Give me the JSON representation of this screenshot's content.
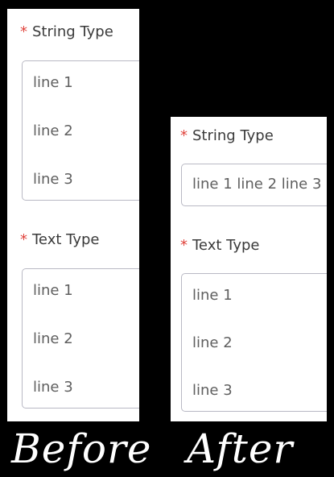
{
  "before": {
    "caption": "Before",
    "fields": [
      {
        "required_mark": "*",
        "label": "String Type",
        "lines": [
          "line 1",
          "line 2",
          "line 3"
        ]
      },
      {
        "required_mark": "*",
        "label": "Text Type",
        "lines": [
          "line 1",
          "line 2",
          "line 3"
        ]
      }
    ]
  },
  "after": {
    "caption": "After",
    "fields": [
      {
        "required_mark": "*",
        "label": "String Type",
        "value": "line 1 line 2 line 3"
      },
      {
        "required_mark": "*",
        "label": "Text Type",
        "lines": [
          "line 1",
          "line 2",
          "line 3"
        ]
      }
    ]
  },
  "colors": {
    "background": "#000000",
    "panel": "#ffffff",
    "required_asterisk": "#e0433c",
    "label_text": "#3a3a3a",
    "field_text": "#5f5f5f",
    "field_border": "#b9b9c4"
  }
}
